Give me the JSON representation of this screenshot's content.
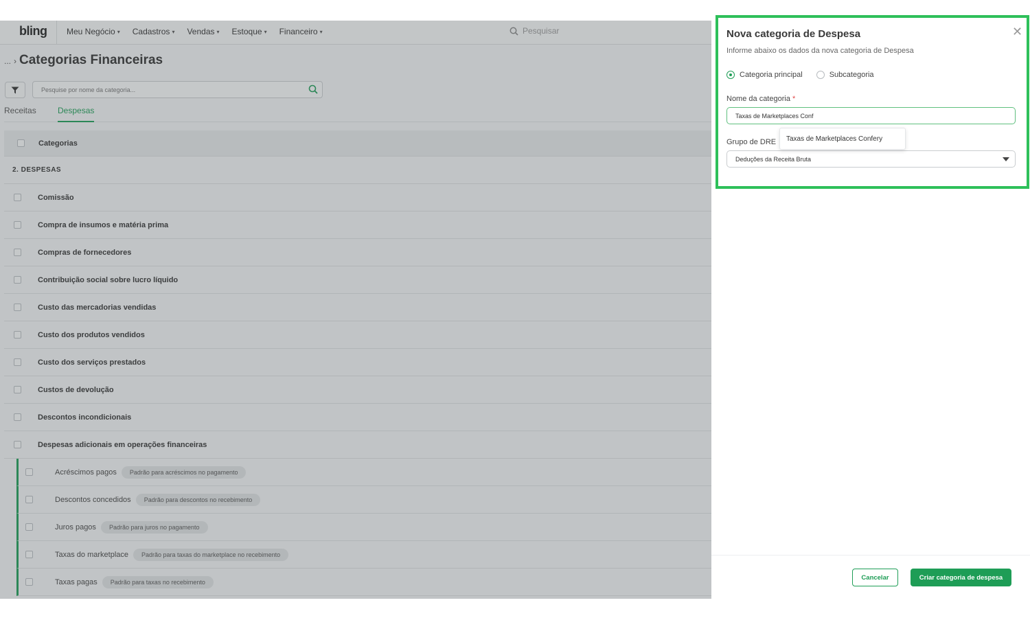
{
  "topbar": {
    "logo": "bling",
    "nav": [
      "Meu Negócio",
      "Cadastros",
      "Vendas",
      "Estoque",
      "Financeiro"
    ],
    "search_placeholder": "Pesquisar"
  },
  "page": {
    "breadcrumb": "...",
    "title": "Categorias Financeiras",
    "search_placeholder": "Pesquise por nome da categoria..."
  },
  "tabs": [
    "Receitas",
    "Despesas"
  ],
  "table": {
    "header": "Categorias",
    "group": "2. DESPESAS",
    "rows": [
      "Comissão",
      "Compra de insumos e matéria prima",
      "Compras de fornecedores",
      "Contribuição social sobre lucro líquido",
      "Custo das mercadorias vendidas",
      "Custo dos produtos vendidos",
      "Custo dos serviços prestados",
      "Custos de devolução",
      "Descontos incondicionais",
      "Despesas adicionais em operações financeiras"
    ],
    "subrows": [
      {
        "label": "Acréscimos pagos",
        "tag": "Padrão para acréscimos no pagamento"
      },
      {
        "label": "Descontos concedidos",
        "tag": "Padrão para descontos no recebimento"
      },
      {
        "label": "Juros pagos",
        "tag": "Padrão para juros no pagamento"
      },
      {
        "label": "Taxas do marketplace",
        "tag": "Padrão para taxas do marketplace no recebimento"
      },
      {
        "label": "Taxas pagas",
        "tag": "Padrão para taxas no recebimento"
      }
    ]
  },
  "panel": {
    "title": "Nova categoria de Despesa",
    "subtitle": "Informe abaixo os dados da nova categoria de Despesa",
    "radio_main": "Categoria principal",
    "radio_sub": "Subcategoria",
    "name_label": "Nome da categoria",
    "required_mark": "*",
    "name_value": "Taxas de Marketplaces Conf",
    "suggestion": "Taxas de Marketplaces Confery",
    "dre_label": "Grupo de DRE",
    "dre_value": "Deduções da Receita Bruta",
    "cancel": "Cancelar",
    "create": "Criar categoria de despesa"
  },
  "colors": {
    "accent": "#1e9d56",
    "highlight_border": "#2ec05a"
  }
}
